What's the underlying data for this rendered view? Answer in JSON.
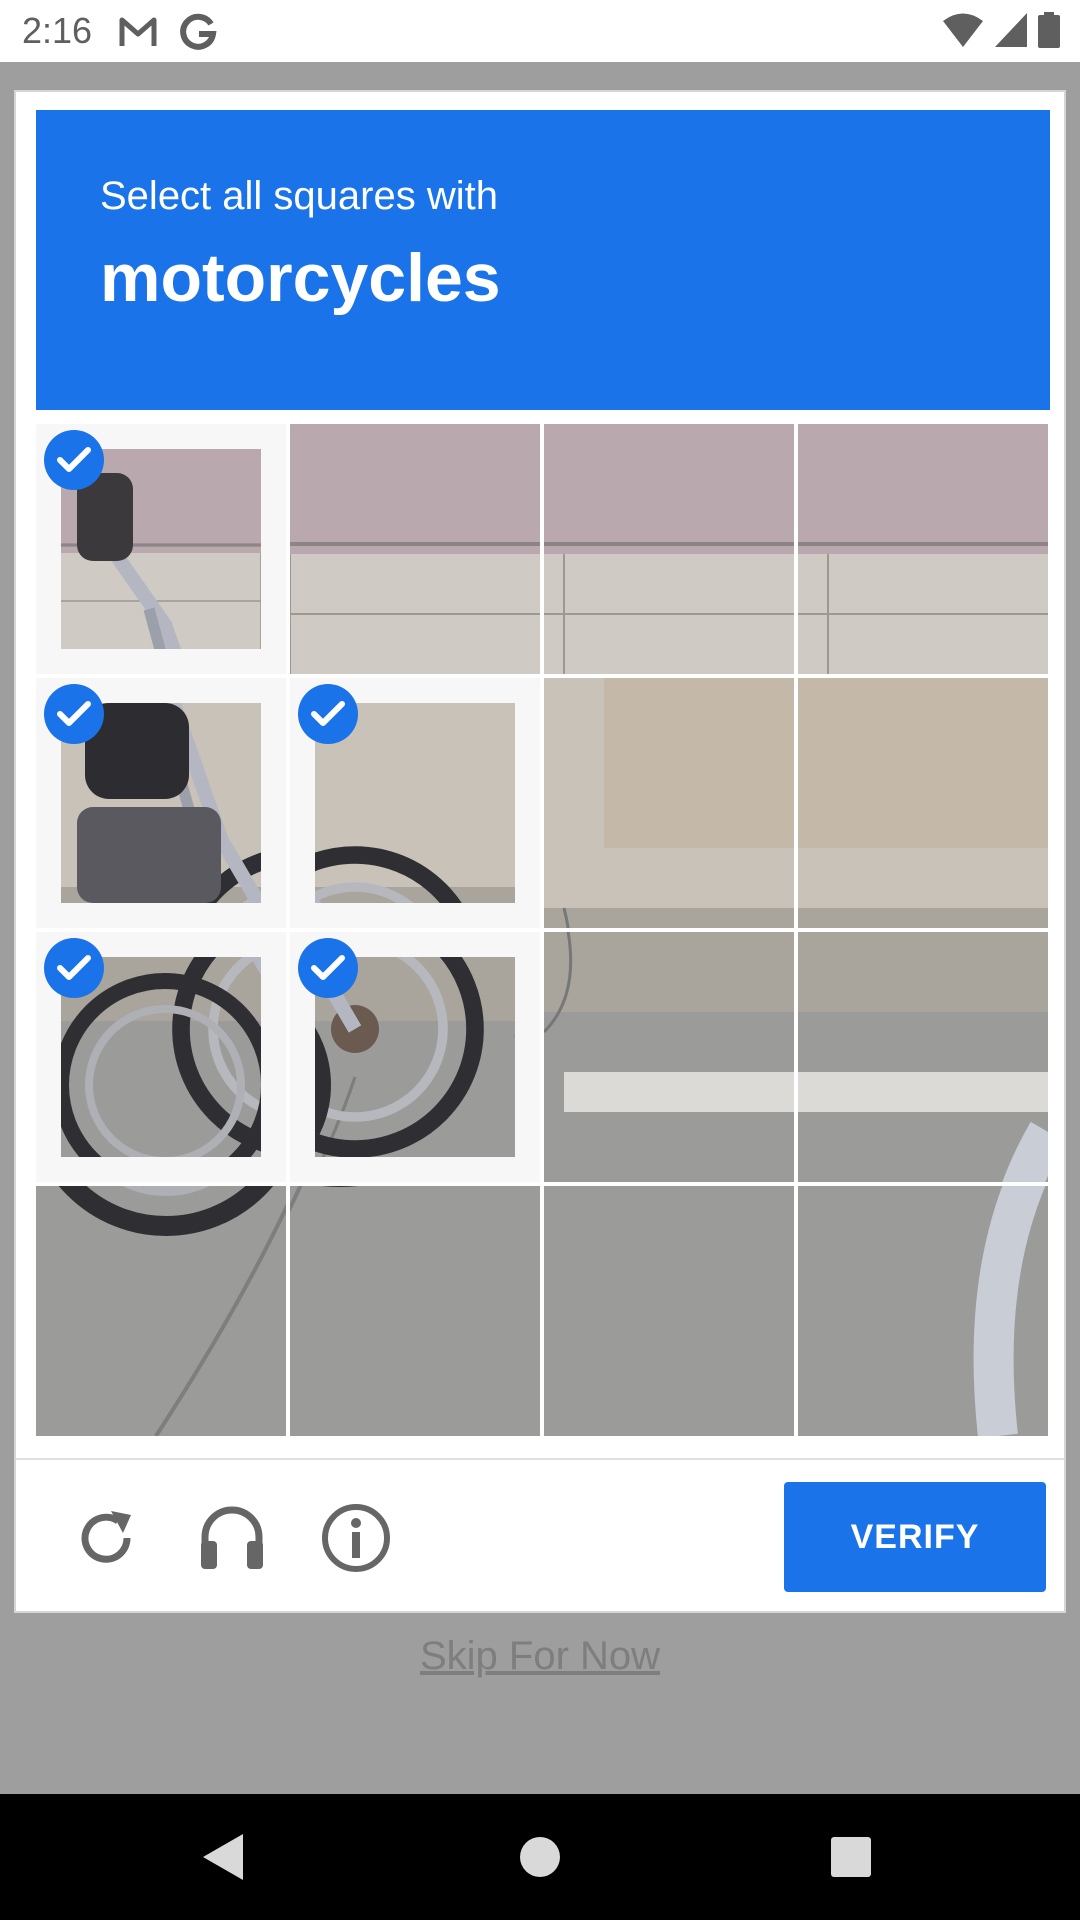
{
  "status_bar": {
    "time": "2:16",
    "icons": [
      "gmail-icon",
      "google-icon",
      "wifi-icon",
      "cell-signal-icon",
      "battery-icon"
    ]
  },
  "captcha": {
    "instruction": "Select all squares with",
    "target": "motorcycles",
    "tiles": [
      {
        "row": 0,
        "col": 0,
        "selected": true
      },
      {
        "row": 0,
        "col": 1,
        "selected": false
      },
      {
        "row": 0,
        "col": 2,
        "selected": false
      },
      {
        "row": 0,
        "col": 3,
        "selected": false
      },
      {
        "row": 1,
        "col": 0,
        "selected": true
      },
      {
        "row": 1,
        "col": 1,
        "selected": true
      },
      {
        "row": 1,
        "col": 2,
        "selected": false
      },
      {
        "row": 1,
        "col": 3,
        "selected": false
      },
      {
        "row": 2,
        "col": 0,
        "selected": true
      },
      {
        "row": 2,
        "col": 1,
        "selected": true
      },
      {
        "row": 2,
        "col": 2,
        "selected": false
      },
      {
        "row": 2,
        "col": 3,
        "selected": false
      },
      {
        "row": 3,
        "col": 0,
        "selected": false
      },
      {
        "row": 3,
        "col": 1,
        "selected": false
      },
      {
        "row": 3,
        "col": 2,
        "selected": false
      },
      {
        "row": 3,
        "col": 3,
        "selected": false
      }
    ],
    "footer_icons": [
      "reload-icon",
      "headphones-icon",
      "info-icon"
    ],
    "verify_label": "VERIFY"
  },
  "skip_label": "Skip For Now",
  "nav_bar": {
    "buttons": [
      "back-icon",
      "home-icon",
      "recents-icon"
    ]
  },
  "colors": {
    "accent": "#1a73e8",
    "scrim": "#9e9e9e"
  }
}
